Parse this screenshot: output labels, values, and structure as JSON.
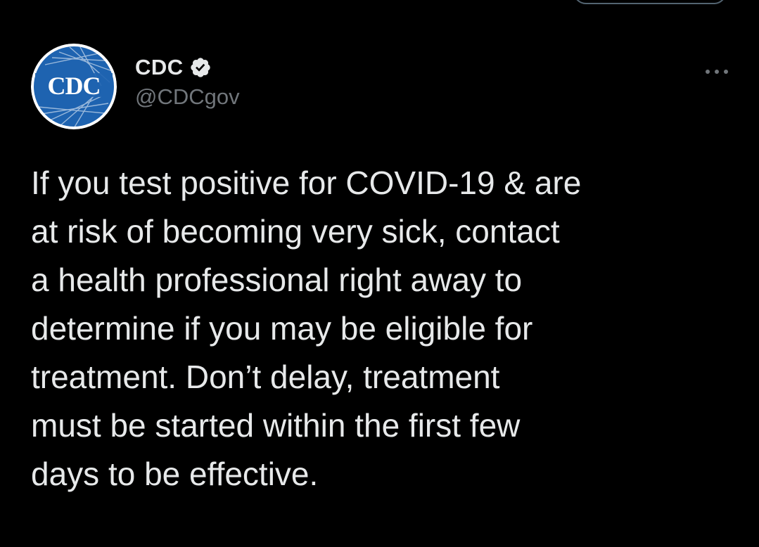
{
  "colors": {
    "background": "#000000",
    "primary_text": "#e7e9ea",
    "secondary_text": "#71767b",
    "avatar_blue": "#1e63b0",
    "verified_badge": "#e7e9ea"
  },
  "author": {
    "avatar_text": "CDC",
    "display_name": "CDC",
    "verified": true,
    "handle": "@CDCgov"
  },
  "icons": {
    "verified": "verified-badge-icon",
    "more": "more-options-icon"
  },
  "tweet": {
    "lines": [
      "If you test positive for COVID-19 & are",
      "at risk of becoming very sick, contact",
      "a health professional right away to",
      "determine if you may be eligible for",
      "treatment. Don’t delay, treatment",
      "must be started within the first few",
      "days to be effective."
    ]
  }
}
